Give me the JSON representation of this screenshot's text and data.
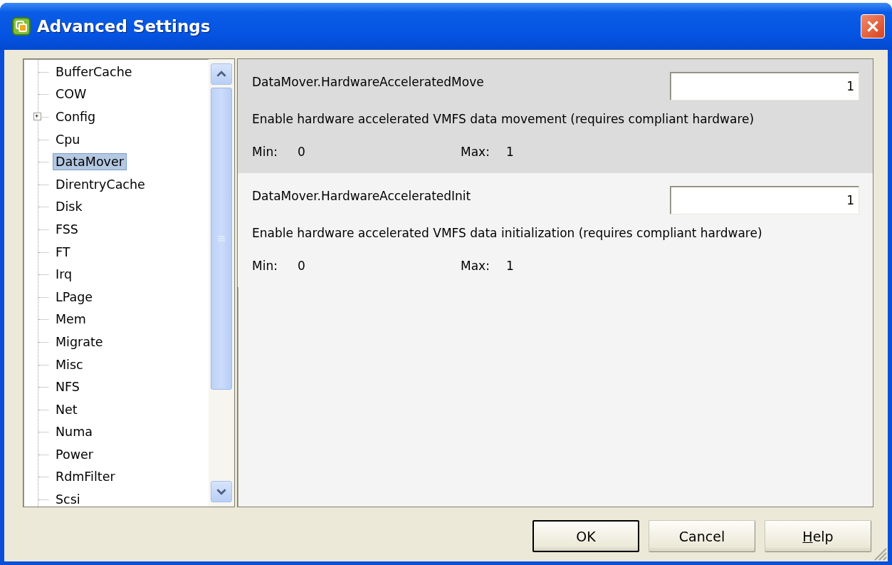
{
  "window": {
    "title": "Advanced Settings"
  },
  "tree": {
    "items": [
      {
        "label": "BufferCache",
        "selected": false
      },
      {
        "label": "COW",
        "selected": false
      },
      {
        "label": "Config",
        "selected": false,
        "expanded": false
      },
      {
        "label": "Cpu",
        "selected": false
      },
      {
        "label": "DataMover",
        "selected": true
      },
      {
        "label": "DirentryCache",
        "selected": false
      },
      {
        "label": "Disk",
        "selected": false
      },
      {
        "label": "FSS",
        "selected": false
      },
      {
        "label": "FT",
        "selected": false
      },
      {
        "label": "Irq",
        "selected": false
      },
      {
        "label": "LPage",
        "selected": false
      },
      {
        "label": "Mem",
        "selected": false
      },
      {
        "label": "Migrate",
        "selected": false
      },
      {
        "label": "Misc",
        "selected": false
      },
      {
        "label": "NFS",
        "selected": false
      },
      {
        "label": "Net",
        "selected": false
      },
      {
        "label": "Numa",
        "selected": false
      },
      {
        "label": "Power",
        "selected": false
      },
      {
        "label": "RdmFilter",
        "selected": false
      },
      {
        "label": "Scsi",
        "selected": false
      }
    ]
  },
  "settings": [
    {
      "name": "DataMover.HardwareAcceleratedMove",
      "value": "1",
      "description": "Enable hardware accelerated VMFS data movement (requires compliant hardware)",
      "min_label": "Min:",
      "min": "0",
      "max_label": "Max:",
      "max": "1",
      "selected": true
    },
    {
      "name": "DataMover.HardwareAcceleratedInit",
      "value": "1",
      "description": "Enable hardware accelerated VMFS data initialization (requires compliant hardware)",
      "min_label": "Min:",
      "min": "0",
      "max_label": "Max:",
      "max": "1",
      "selected": false
    }
  ],
  "buttons": [
    {
      "label": "OK",
      "default": true,
      "mnemonic_first": false
    },
    {
      "label": "Cancel",
      "default": false,
      "mnemonic_first": false
    },
    {
      "label": "Help",
      "default": false,
      "mnemonic_first": true
    }
  ]
}
